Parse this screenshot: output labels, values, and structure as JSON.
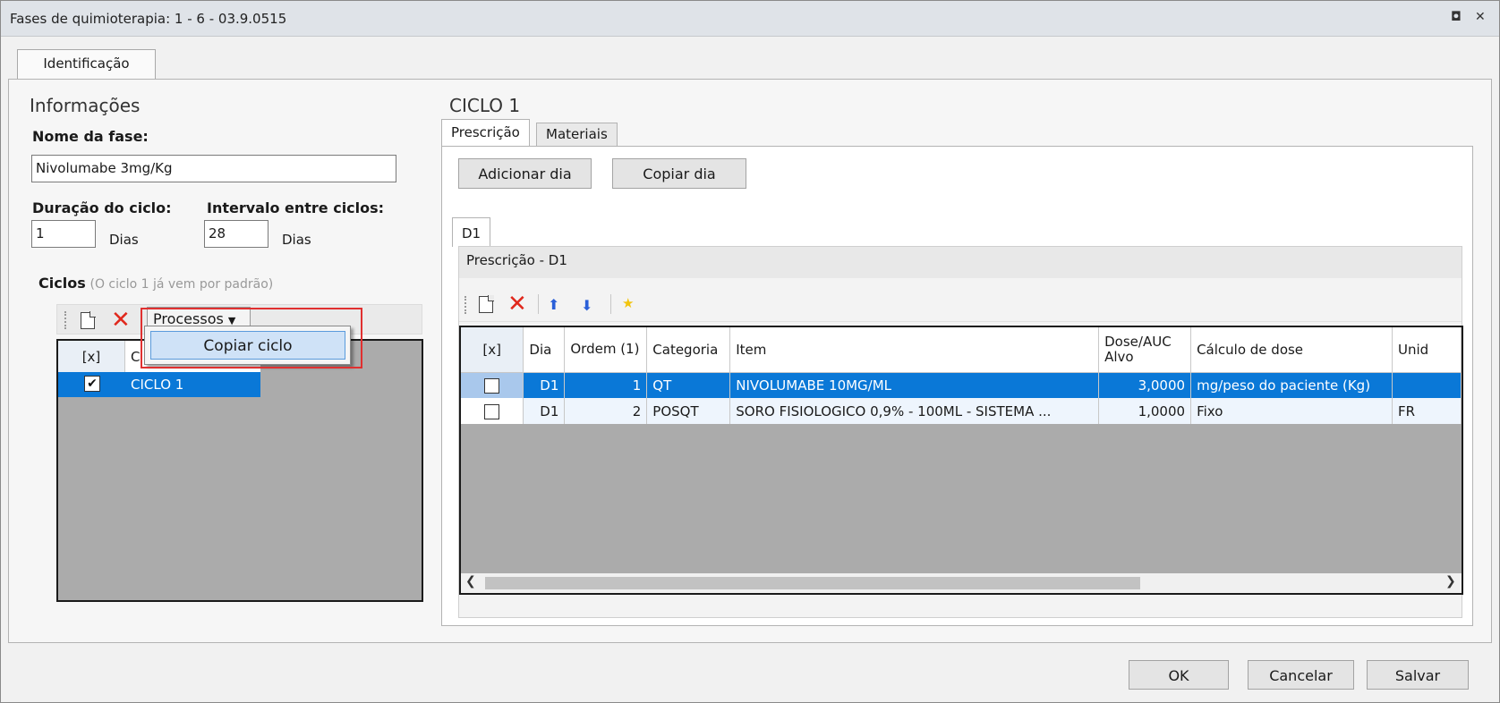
{
  "window": {
    "title": "Fases de quimioterapia: 1 - 6 - 03.9.0515",
    "restore_symbol": "◘",
    "close_symbol": "✕"
  },
  "tabs": {
    "identificacao": "Identificação"
  },
  "info": {
    "heading": "Informações",
    "nome_label": "Nome da fase:",
    "nome_value": "Nivolumabe 3mg/Kg",
    "duracao_label": "Duração do ciclo:",
    "duracao_value": "1",
    "duracao_unit": "Dias",
    "intervalo_label": "Intervalo entre ciclos:",
    "intervalo_value": "28",
    "intervalo_unit": "Dias"
  },
  "ciclos": {
    "label": "Ciclos",
    "hint": "(O ciclo 1 já vem por padrão)",
    "processos_label": "Processos",
    "grid_header_check": "[x]",
    "grid_header_col": "C",
    "row_label": "CICLO 1",
    "menu_item": "Copiar ciclo"
  },
  "ciclo": {
    "heading": "CICLO 1",
    "tab_prescricao": "Prescrição",
    "tab_materiais": "Materiais",
    "btn_add_dia": "Adicionar dia",
    "btn_copiar_dia": "Copiar dia",
    "day_tab": "D1",
    "panel_title": "Prescrição - D1"
  },
  "grid": {
    "columns": [
      "[x]",
      "Dia",
      "Ordem (1)",
      "Categoria",
      "Item",
      "Dose/AUC Alvo",
      "Cálculo de dose",
      "Unid"
    ],
    "rows": [
      {
        "dia": "D1",
        "ordem": "1",
        "categoria": "QT",
        "item": "NIVOLUMABE 10MG/ML",
        "dose": "3,0000",
        "calculo": "mg/peso do paciente (Kg)",
        "unid": ""
      },
      {
        "dia": "D1",
        "ordem": "2",
        "categoria": "POSQT",
        "item": "SORO FISIOLOGICO 0,9% - 100ML - SISTEMA ...",
        "dose": "1,0000",
        "calculo": "Fixo",
        "unid": "FR"
      }
    ]
  },
  "footer": {
    "ok": "OK",
    "cancelar": "Cancelar",
    "salvar": "Salvar"
  },
  "colors": {
    "selection": "#0a78d7",
    "delete": "#e0281c",
    "highlight_box": "#e03030",
    "arrow": "#2a5fd8",
    "star": "#f2c40c"
  }
}
